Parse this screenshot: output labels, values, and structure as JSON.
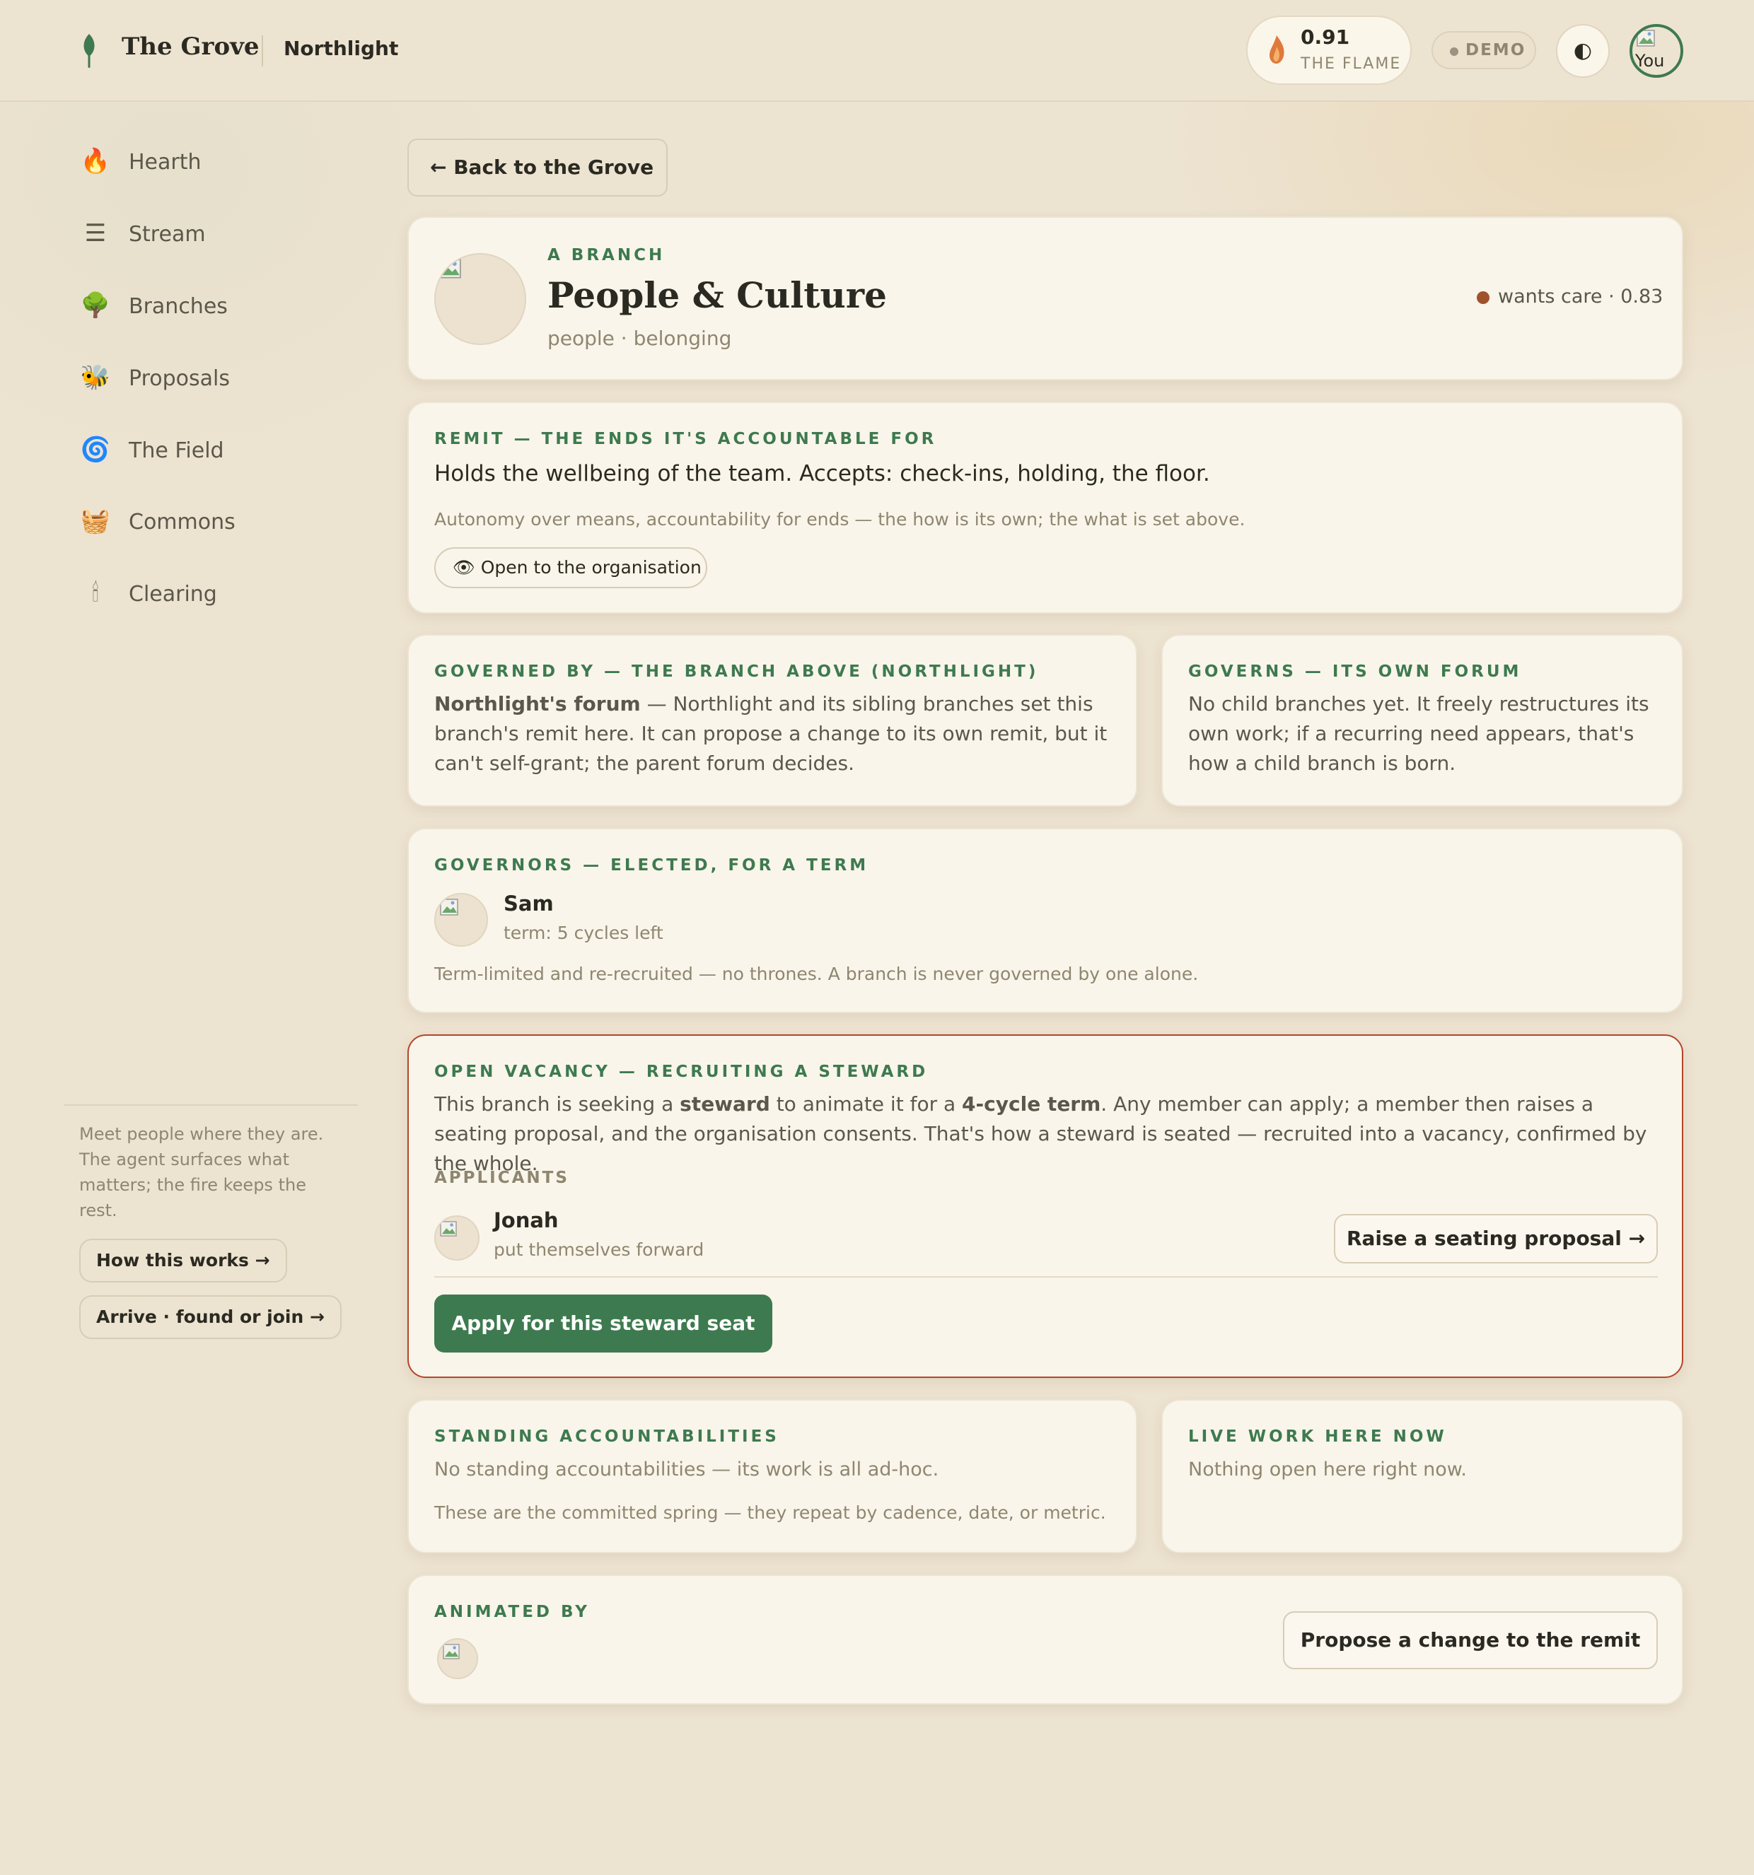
{
  "header": {
    "app_title": "The Grove",
    "org_name": "Northlight",
    "flame_value": "0.91",
    "flame_label": "THE FLAME",
    "mode_badge": "DEMO",
    "theme_toggle_glyph": "◐",
    "user_avatar_alt": "You"
  },
  "sidebar": {
    "items": [
      {
        "icon": "fire-icon",
        "glyph": "🔥",
        "label": "Hearth"
      },
      {
        "icon": "list-icon",
        "glyph": "☰",
        "label": "Stream"
      },
      {
        "icon": "tree-icon",
        "glyph": "🌳",
        "label": "Branches"
      },
      {
        "icon": "bee-icon",
        "glyph": "🐝",
        "label": "Proposals"
      },
      {
        "icon": "spiral-icon",
        "glyph": "🌀",
        "label": "The Field"
      },
      {
        "icon": "basket-icon",
        "glyph": "🧺",
        "label": "Commons"
      },
      {
        "icon": "candle-icon",
        "glyph": "🕯",
        "label": "Clearing"
      }
    ],
    "note": "Meet people where they are. The agent surfaces what matters; the fire keeps the rest.",
    "how_button": "How this works →",
    "arrive_button": "Arrive · found or join →"
  },
  "main": {
    "back_button": "← Back to the Grove",
    "branch": {
      "eyebrow": "A BRANCH",
      "name": "People & Culture",
      "tags": "people · belonging",
      "status": "wants care · 0.83",
      "status_color": "#a0522d"
    },
    "remit": {
      "eyebrow": "REMIT — THE ENDS IT'S ACCOUNTABLE FOR",
      "statement": "Holds the wellbeing of the team. Accepts: check-ins, holding, the floor.",
      "note": "Autonomy over means, accountability for ends — the how is its own; the what is set above.",
      "visibility_icon": "👁",
      "visibility": "Open to the organisation"
    },
    "governed_by": {
      "eyebrow": "GOVERNED BY — THE BRANCH ABOVE (NORTHLIGHT)",
      "forum": "Northlight's forum",
      "text": " — Northlight and its sibling branches set this branch's remit here. It can propose a change to its own remit, but it can't self-grant; the parent forum decides."
    },
    "governs": {
      "eyebrow": "GOVERNS — ITS OWN FORUM",
      "text": "No child branches yet. It freely restructures its own work; if a recurring need appears, that's how a child branch is born."
    },
    "governors": {
      "eyebrow": "GOVERNORS — ELECTED, FOR A TERM",
      "name": "Sam",
      "term": "term: 5 cycles left",
      "note": "Term-limited and re-recruited — no thrones. A branch is never governed by one alone."
    },
    "vacancy": {
      "eyebrow": "OPEN VACANCY — RECRUITING A STEWARD",
      "text_1": "This branch is seeking a ",
      "role": "steward",
      "text_2": " to animate it for a ",
      "term": "4-cycle term",
      "text_3": ". Any member can apply; a member then raises a seating proposal, and the organisation consents. That's how a steward is seated — recruited into a vacancy, confirmed by the whole.",
      "applicants_label": "APPLICANTS",
      "applicant_name": "Jonah",
      "applicant_note": "put themselves forward",
      "raise_button": "Raise a seating proposal →",
      "apply_button": "Apply for this steward seat",
      "accent": "#b5452a"
    },
    "standing": {
      "eyebrow": "STANDING ACCOUNTABILITIES",
      "text": "No standing accountabilities — its work is all ad-hoc.",
      "note": "These are the committed spring — they repeat by cadence, date, or metric."
    },
    "live_work": {
      "eyebrow": "LIVE WORK HERE NOW",
      "text": "Nothing open here right now."
    },
    "animated_by": {
      "eyebrow": "ANIMATED BY",
      "propose_button": "Propose a change to the remit"
    }
  },
  "colors": {
    "background": "#ede3d1",
    "card": "#f9f5ea",
    "accent_green": "#3e7a4f",
    "ink": "#2b2a22",
    "muted": "#8f8670"
  }
}
